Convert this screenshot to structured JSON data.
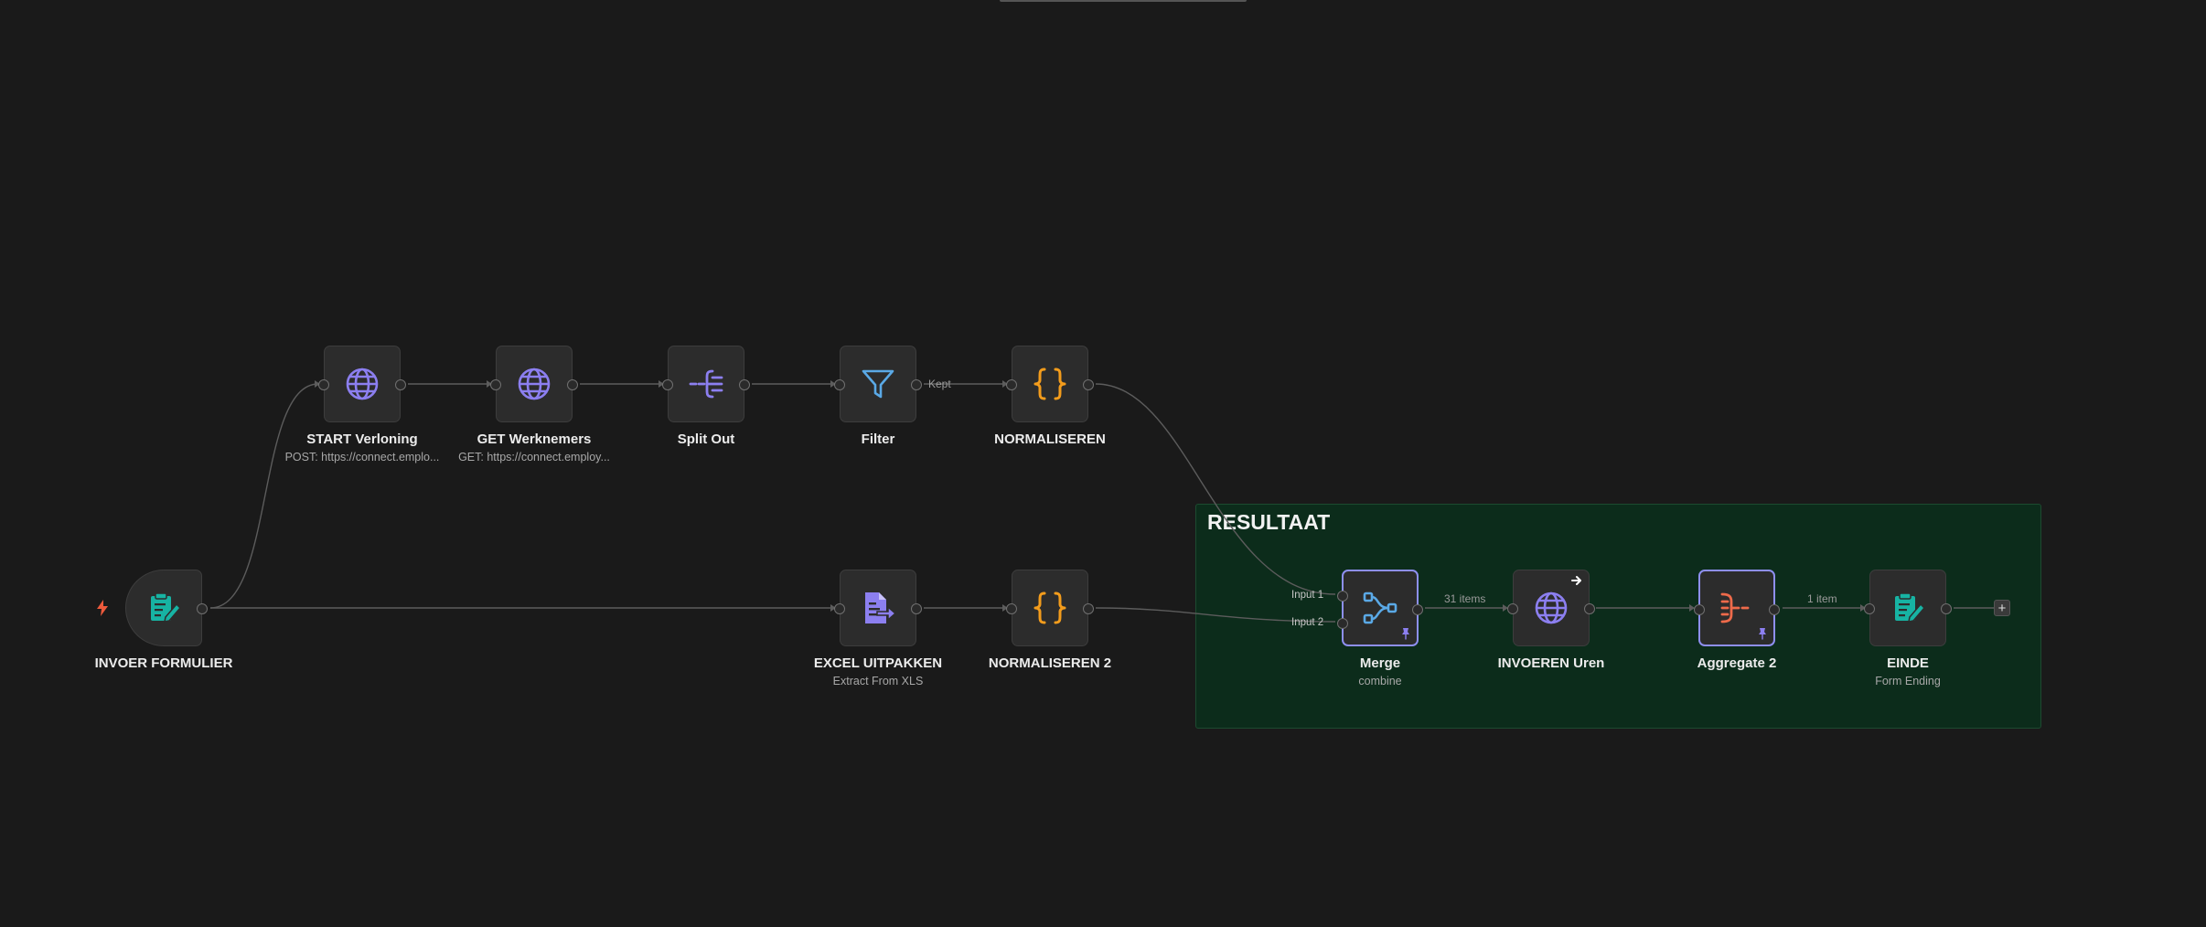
{
  "sticky": {
    "title": "RESULTAAT"
  },
  "nodes": {
    "invoer_formulier": {
      "name": "INVOER FORMULIER",
      "icon": "form-icon"
    },
    "start_verloning": {
      "name": "START Verloning",
      "subtitle": "POST: https://connect.emplo...",
      "icon": "globe-icon"
    },
    "get_werknemers": {
      "name": "GET Werknemers",
      "subtitle": "GET: https://connect.employ...",
      "icon": "globe-icon"
    },
    "split_out": {
      "name": "Split Out",
      "icon": "split-out-icon"
    },
    "filter": {
      "name": "Filter",
      "icon": "funnel-icon"
    },
    "normaliseren": {
      "name": "NORMALISEREN",
      "icon": "code-braces-icon"
    },
    "excel_uitpakken": {
      "name": "EXCEL UITPAKKEN",
      "subtitle": "Extract From XLS",
      "icon": "file-export-icon"
    },
    "normaliseren_2": {
      "name": "NORMALISEREN 2",
      "icon": "code-braces-icon"
    },
    "merge": {
      "name": "Merge",
      "subtitle": "combine",
      "icon": "merge-icon",
      "input1": "Input 1",
      "input2": "Input 2"
    },
    "invoeren_uren": {
      "name": "INVOEREN Uren",
      "icon": "globe-icon"
    },
    "aggregate_2": {
      "name": "Aggregate 2",
      "icon": "aggregate-icon"
    },
    "einde": {
      "name": "EINDE",
      "subtitle": "Form Ending",
      "icon": "form-icon"
    }
  },
  "edge_labels": {
    "filter_kept": "Kept",
    "merge_items": "31 items",
    "aggregate_items": "1 item"
  },
  "add_button": "+",
  "colors": {
    "canvas": "#1a1a1a",
    "node_bg": "#2c2c2c",
    "selected_border": "#8e8ff0",
    "teal": "#17b3a3",
    "purple": "#8c7ff0",
    "blue": "#5aa9e6",
    "orange": "#f39c1c",
    "red_orange": "#ee6a4a",
    "sticky_bg": "#0c2c1b"
  }
}
